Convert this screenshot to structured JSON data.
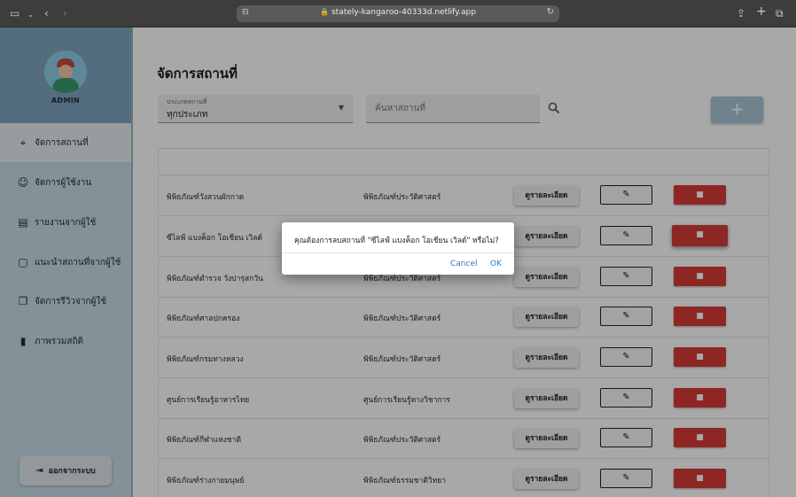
{
  "browser": {
    "url": "stately-kangaroo-40333d.netlify.app"
  },
  "sidebar": {
    "admin_label": "ADMIN",
    "items": [
      {
        "label": "จัดการสถานที่",
        "icon": "location-add-icon",
        "active": true
      },
      {
        "label": "จัดการผู้ใช้งาน",
        "icon": "user-manage-icon",
        "active": false
      },
      {
        "label": "รายงานจากผู้ใช้",
        "icon": "report-icon",
        "active": false
      },
      {
        "label": "แนะนำสถานที่จากผู้ใช้",
        "icon": "chat-icon",
        "active": false
      },
      {
        "label": "จัดการรีวิวจากผู้ใช้",
        "icon": "review-icon",
        "active": false
      },
      {
        "label": "ภาพรวมสถิติ",
        "icon": "bar-chart-icon",
        "active": false
      }
    ],
    "logout_label": "ออกจากระบบ"
  },
  "main": {
    "title": "จัดการสถานที่",
    "filter": {
      "label": "ประเภทสถานที่",
      "value": "ทุกประเภท"
    },
    "search": {
      "placeholder": "ค้นหาสถานที่"
    },
    "add_label": "+",
    "rows": [
      {
        "name": "พิพิธภัณฑ์วังสวนผักกาด",
        "type": "พิพิธภัณฑ์ประวัติศาสตร์",
        "detail": "ดูรายละเอียด"
      },
      {
        "name": "ซีไลฟ์ แบงค็อก โอเชียน เวิลด์",
        "type": "",
        "detail": "ดูรายละเอียด"
      },
      {
        "name": "พิพิธภัณฑ์ตำรวจ วังปารุสกวัน",
        "type": "พิพิธภัณฑ์ประวัติศาสตร์",
        "detail": "ดูรายละเอียด"
      },
      {
        "name": "พิพิธภัณฑ์ศาลปกครอง",
        "type": "พิพิธภัณฑ์ประวัติศาสตร์",
        "detail": "ดูรายละเอียด"
      },
      {
        "name": "พิพิธภัณฑ์กรมทางหลวง",
        "type": "พิพิธภัณฑ์ประวัติศาสตร์",
        "detail": "ดูรายละเอียด"
      },
      {
        "name": "ศูนย์การเรียนรู้อาหารไทย",
        "type": "ศูนย์การเรียนรู้ทางวิชาการ",
        "detail": "ดูรายละเอียด"
      },
      {
        "name": "พิพิธภัณฑ์กีฬาแห่งชาติ",
        "type": "พิพิธภัณฑ์ประวัติศาสตร์",
        "detail": "ดูรายละเอียด"
      },
      {
        "name": "พิพิธภัณฑ์ร่างกายมนุษย์",
        "type": "พิพิธภัณฑ์ธรรมชาติวิทยา",
        "detail": "ดูรายละเอียด"
      }
    ]
  },
  "dialog": {
    "message": "คุณต้องการลบสถานที่ \"ซีไลฟ์ แบงค็อก โอเชียน เวิลด์\" หรือไม่?",
    "cancel": "Cancel",
    "ok": "OK"
  }
}
